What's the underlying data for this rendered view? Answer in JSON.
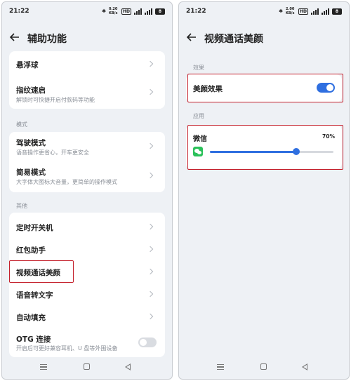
{
  "left": {
    "status": {
      "time": "21:22",
      "net": "0.20 KB/s",
      "hd": "HD",
      "batt": "8"
    },
    "header": {
      "title": "辅助功能"
    },
    "group1": [
      {
        "label": "悬浮球",
        "sub": ""
      },
      {
        "label": "指纹速启",
        "sub": "解锁时可快捷开启付款码等功能"
      }
    ],
    "section_mode": "模式",
    "group2": [
      {
        "label": "驾驶模式",
        "sub": "语音操作更省心，开车更安全"
      },
      {
        "label": "简易模式",
        "sub": "大字体大图标大音量，更简单的操作模式"
      }
    ],
    "section_other": "其他",
    "group3": [
      {
        "label": "定时开关机",
        "sub": ""
      },
      {
        "label": "红包助手",
        "sub": ""
      },
      {
        "label": "视频通话美颜",
        "sub": ""
      },
      {
        "label": "语音转文字",
        "sub": ""
      },
      {
        "label": "自动填充",
        "sub": ""
      },
      {
        "label": "OTG 连接",
        "sub": "开启后可更好兼容耳机、U 盘等外围设备"
      }
    ],
    "otg_on": false
  },
  "right": {
    "status": {
      "time": "21:22",
      "net": "2.00 KB/s",
      "hd": "HD",
      "batt": "8"
    },
    "header": {
      "title": "视频通话美颜"
    },
    "section_effect": "效果",
    "beauty_label": "美颜效果",
    "beauty_on": true,
    "section_apps": "应用",
    "app": {
      "name": "微信",
      "level_text": "70%",
      "level": 0.7
    }
  },
  "colors": {
    "accent": "#2f6fe0",
    "highlight": "#c41f2b",
    "wechat": "#2bc15a"
  }
}
